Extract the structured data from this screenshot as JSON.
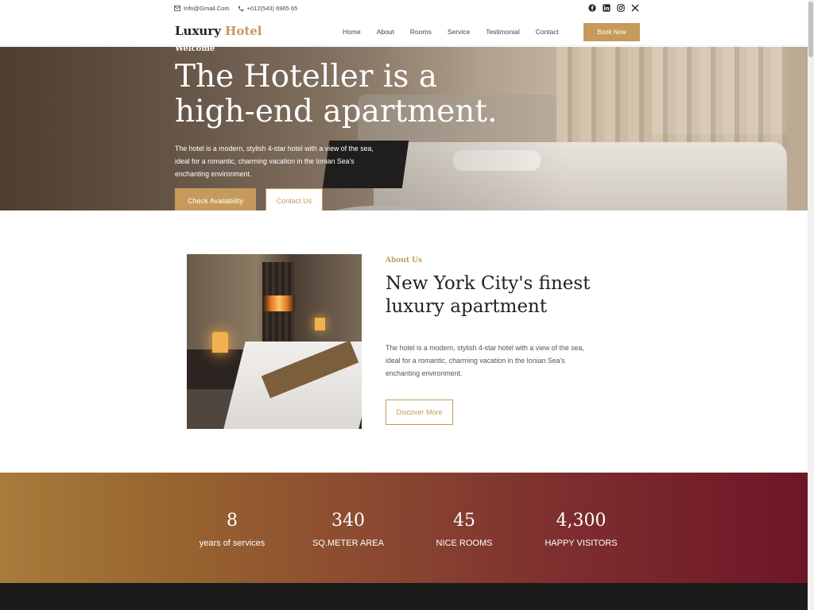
{
  "topbar": {
    "email": "Info@Gmail.Com",
    "phone": "+012(543) 6965 65",
    "social_icons": [
      "facebook-icon",
      "linkedin-icon",
      "instagram-icon",
      "x-icon"
    ]
  },
  "nav": {
    "logo_main": "Luxury",
    "logo_accent": "Hotel",
    "items": [
      "Home",
      "About",
      "Rooms",
      "Service",
      "Testimonial",
      "Contact"
    ],
    "book_label": "Book Now"
  },
  "hero": {
    "welcome": "Welcome",
    "title": "The Hoteller is a high-end apartment.",
    "description": "The hotel is a modern, stylish 4-star hotel with a view of the sea, ideal for a romantic, charming vacation in the Ionian Sea's enchanting environment.",
    "primary_button": "Check Availability",
    "secondary_button": "Contact Us"
  },
  "about": {
    "subtitle": "About Us",
    "title": "New York City's finest luxury apartment",
    "description": "The hotel is a modern, stylish 4-star hotel with a view of the sea, ideal for a romantic, charming vacation in the Ionian Sea's enchanting environment.",
    "button": "Discover More"
  },
  "stats": [
    {
      "value": "8",
      "label": "years of services"
    },
    {
      "value": "340",
      "label": "SQ.METER AREA"
    },
    {
      "value": "45",
      "label": "NICE ROOMS"
    },
    {
      "value": "4,300",
      "label": "HAPPY VISITORS"
    }
  ],
  "colors": {
    "accent": "#c59a5b",
    "stats_gradient_start": "#a77c3c",
    "stats_gradient_end": "#6e1527",
    "footer": "#1b1b1b"
  }
}
